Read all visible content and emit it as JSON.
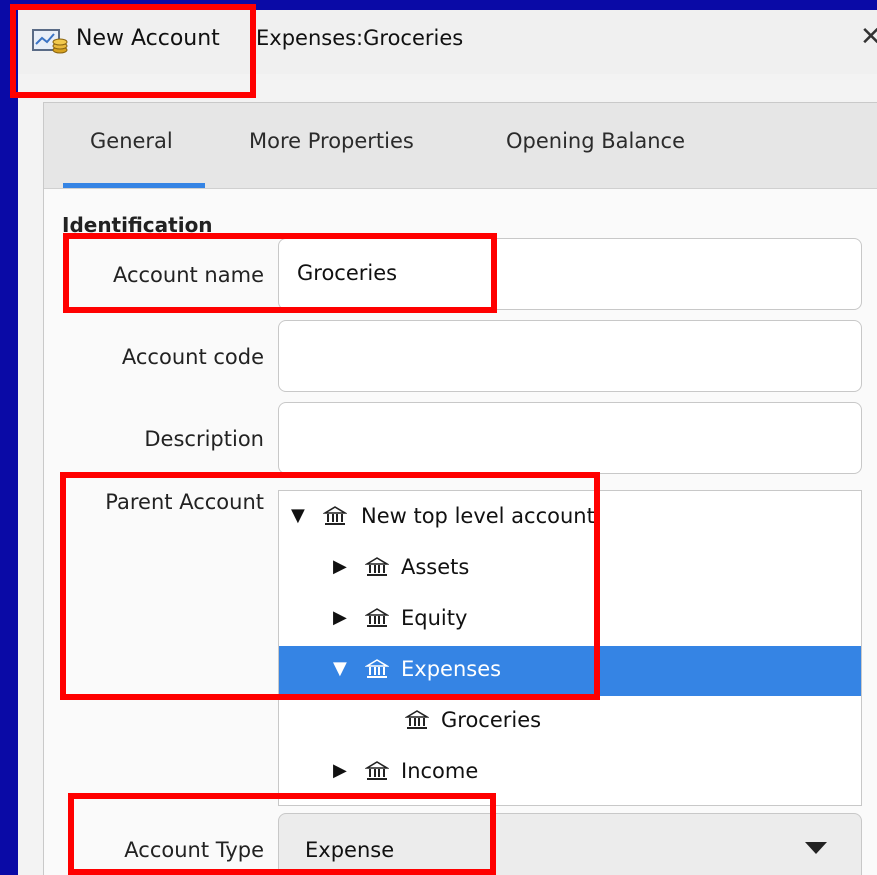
{
  "window": {
    "title_primary": "New Account",
    "title_secondary": "Expenses:Groceries",
    "close_glyph": "✕"
  },
  "tabs": [
    {
      "label": "General",
      "active": true
    },
    {
      "label": "More Properties",
      "active": false
    },
    {
      "label": "Opening Balance",
      "active": false
    }
  ],
  "identification": {
    "section_title": "Identification",
    "account_name": {
      "label": "Account name",
      "value": "Groceries"
    },
    "account_code": {
      "label": "Account code",
      "value": ""
    },
    "description": {
      "label": "Description",
      "value": ""
    },
    "parent_account": {
      "label": "Parent Account",
      "tree": [
        {
          "label": "New top level account",
          "expanded": true,
          "selected": false,
          "icon": "bank-icon"
        },
        {
          "label": "Assets",
          "expanded": false,
          "selected": false,
          "icon": "bank-icon"
        },
        {
          "label": "Equity",
          "expanded": false,
          "selected": false,
          "icon": "bank-icon"
        },
        {
          "label": "Expenses",
          "expanded": true,
          "selected": true,
          "icon": "bank-icon"
        },
        {
          "label": "Groceries",
          "expanded": null,
          "selected": false,
          "icon": "bank-icon"
        },
        {
          "label": "Income",
          "expanded": false,
          "selected": false,
          "icon": "bank-icon"
        }
      ]
    },
    "account_type": {
      "label": "Account Type",
      "value": "Expense"
    }
  },
  "colors": {
    "accent": "#3584e4",
    "highlight": "#ff0000",
    "background": "#0a0aa6"
  }
}
